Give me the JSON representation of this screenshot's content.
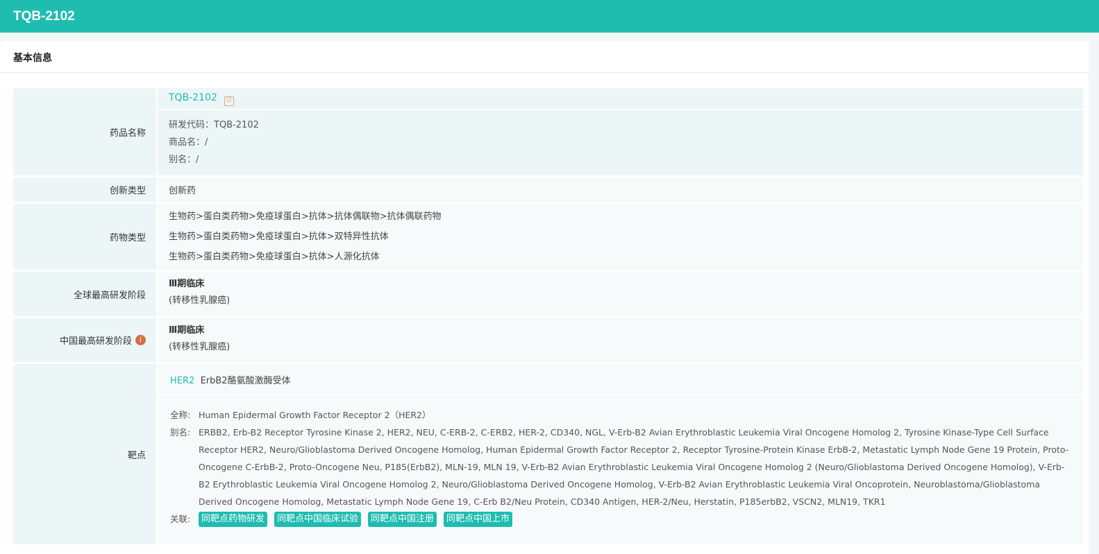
{
  "header": {
    "title": "TQB-2102"
  },
  "section": {
    "title": "基本信息"
  },
  "drug_name": {
    "label": "药品名称",
    "name": "TQB-2102",
    "code": "研发代码：TQB-2102",
    "trade": "商品名：/",
    "alias": "别名：/"
  },
  "innovation": {
    "label": "创新类型",
    "value": "创新药"
  },
  "drug_type": {
    "label": "药物类型",
    "values": [
      "生物药>蛋白类药物>免疫球蛋白>抗体>抗体偶联物>抗体偶联药物",
      "生物药>蛋白类药物>免疫球蛋白>抗体>双特异性抗体",
      "生物药>蛋白类药物>免疫球蛋白>抗体>人源化抗体"
    ]
  },
  "global_stage": {
    "label": "全球最高研发阶段",
    "stage": "Ⅲ期临床",
    "indication": "(转移性乳腺癌)"
  },
  "china_stage": {
    "label": "中国最高研发阶段",
    "info_icon": "i",
    "stage": "Ⅲ期临床",
    "indication": "(转移性乳腺癌)"
  },
  "target": {
    "label": "靶点",
    "code": "HER2",
    "name": "ErbB2酪氨酸激酶受体",
    "full_label": "全称:",
    "full": "Human Epidermal Growth Factor Receptor 2（HER2）",
    "alias_label": "别名:",
    "alias": "ERBB2, Erb-B2 Receptor Tyrosine Kinase 2, HER2, NEU, C-ERB-2, C-ERB2, HER-2, CD340, NGL, V-Erb-B2 Avian Erythroblastic Leukemia Viral Oncogene Homolog 2, Tyrosine Kinase-Type Cell Surface Receptor HER2, Neuro/Glioblastoma Derived Oncogene Homolog, Human Epidermal Growth Factor Receptor 2, Receptor Tyrosine-Protein Kinase ErbB-2, Metastatic Lymph Node Gene 19 Protein, Proto-Oncogene C-ErbB-2, Proto-Oncogene Neu, P185(ErbB2), MLN-19, MLN 19, V-Erb-B2 Avian Erythroblastic Leukemia Viral Oncogene Homolog 2 (Neuro/Glioblastoma Derived Oncogene Homolog), V-Erb-B2 Erythroblastic Leukemia Viral Oncogene Homolog 2, Neuro/Glioblastoma Derived Oncogene Homolog, V-Erb-B2 Avian Erythroblastic Leukemia Viral Oncoprotein, Neuroblastoma/Glioblastoma Derived Oncogene Homolog, Metastatic Lymph Node Gene 19, C-Erb B2/Neu Protein, CD340 Antigen, HER-2/Neu, Herstatin, P185erbB2, VSCN2, MLN19, TKR1",
    "related_label": "关联:",
    "tags": [
      "同靶点药物研发",
      "同靶点中国临床试验",
      "同靶点中国注册",
      "同靶点中国上市"
    ]
  }
}
